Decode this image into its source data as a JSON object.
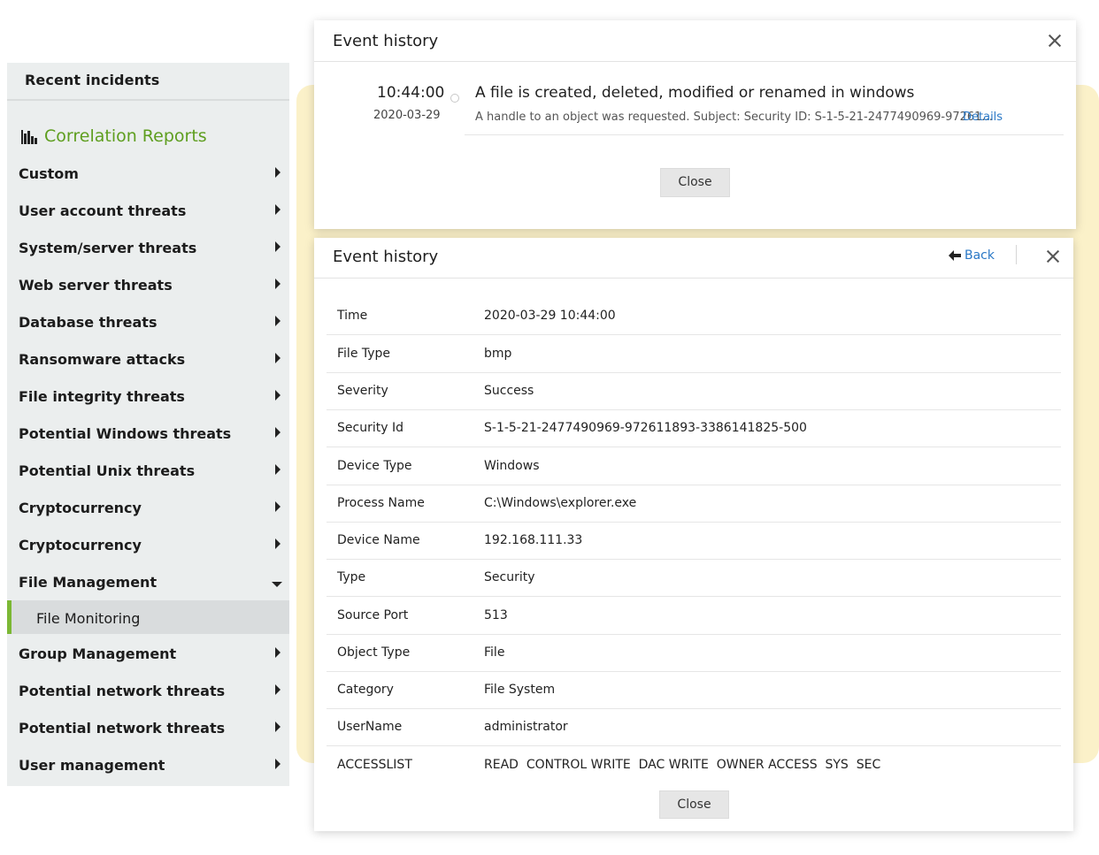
{
  "sidebar": {
    "recent_label": "Recent incidents",
    "section_title": "Correlation Reports",
    "section_icon": "bar-chart-icon",
    "accent_color": "#5e9e1f",
    "items": [
      {
        "label": "Custom"
      },
      {
        "label": "User account threats"
      },
      {
        "label": "System/server threats"
      },
      {
        "label": "Web server threats"
      },
      {
        "label": "Database threats"
      },
      {
        "label": "Ransomware attacks"
      },
      {
        "label": "File integrity threats"
      },
      {
        "label": "Potential Windows threats"
      },
      {
        "label": "Potential Unix threats"
      },
      {
        "label": "Cryptocurrency"
      },
      {
        "label": "Cryptocurrency"
      },
      {
        "label": "File Management"
      },
      {
        "label": "Group Management"
      },
      {
        "label": "Potential network threats"
      },
      {
        "label": "Potential network threats"
      },
      {
        "label": "User management"
      }
    ],
    "expanded_item": "File Management",
    "sub_item": "File Monitoring"
  },
  "panel1": {
    "title": "Event history",
    "event": {
      "time": "10:44:00",
      "date": "2020-03-29",
      "title": "A file is created, deleted, modified or renamed in windows",
      "description": "A handle to an object was requested. Subject: Security ID: S-1-5-21-2477490969-97261...",
      "link": "Details"
    },
    "close_label": "Close"
  },
  "panel2": {
    "title": "Event history",
    "back_label": "Back",
    "rows": [
      {
        "key": "Time",
        "value": "2020-03-29 10:44:00"
      },
      {
        "key": "File Type",
        "value": "bmp"
      },
      {
        "key": "Severity",
        "value": "Success"
      },
      {
        "key": "Security Id",
        "value": "S-1-5-21-2477490969-972611893-3386141825-500"
      },
      {
        "key": "Device Type",
        "value": "Windows"
      },
      {
        "key": "Process Name",
        "value": "C:\\Windows\\explorer.exe"
      },
      {
        "key": "Device Name",
        "value": "192.168.111.33"
      },
      {
        "key": "Type",
        "value": "Security"
      },
      {
        "key": "Source Port",
        "value": "513"
      },
      {
        "key": "Object Type",
        "value": "File"
      },
      {
        "key": "Category",
        "value": "File System"
      },
      {
        "key": "UserName",
        "value": "administrator"
      },
      {
        "key": "ACCESSLIST",
        "value": "READ  CONTROL WRITE  DAC WRITE  OWNER ACCESS  SYS  SEC"
      }
    ],
    "close_label": "Close"
  }
}
